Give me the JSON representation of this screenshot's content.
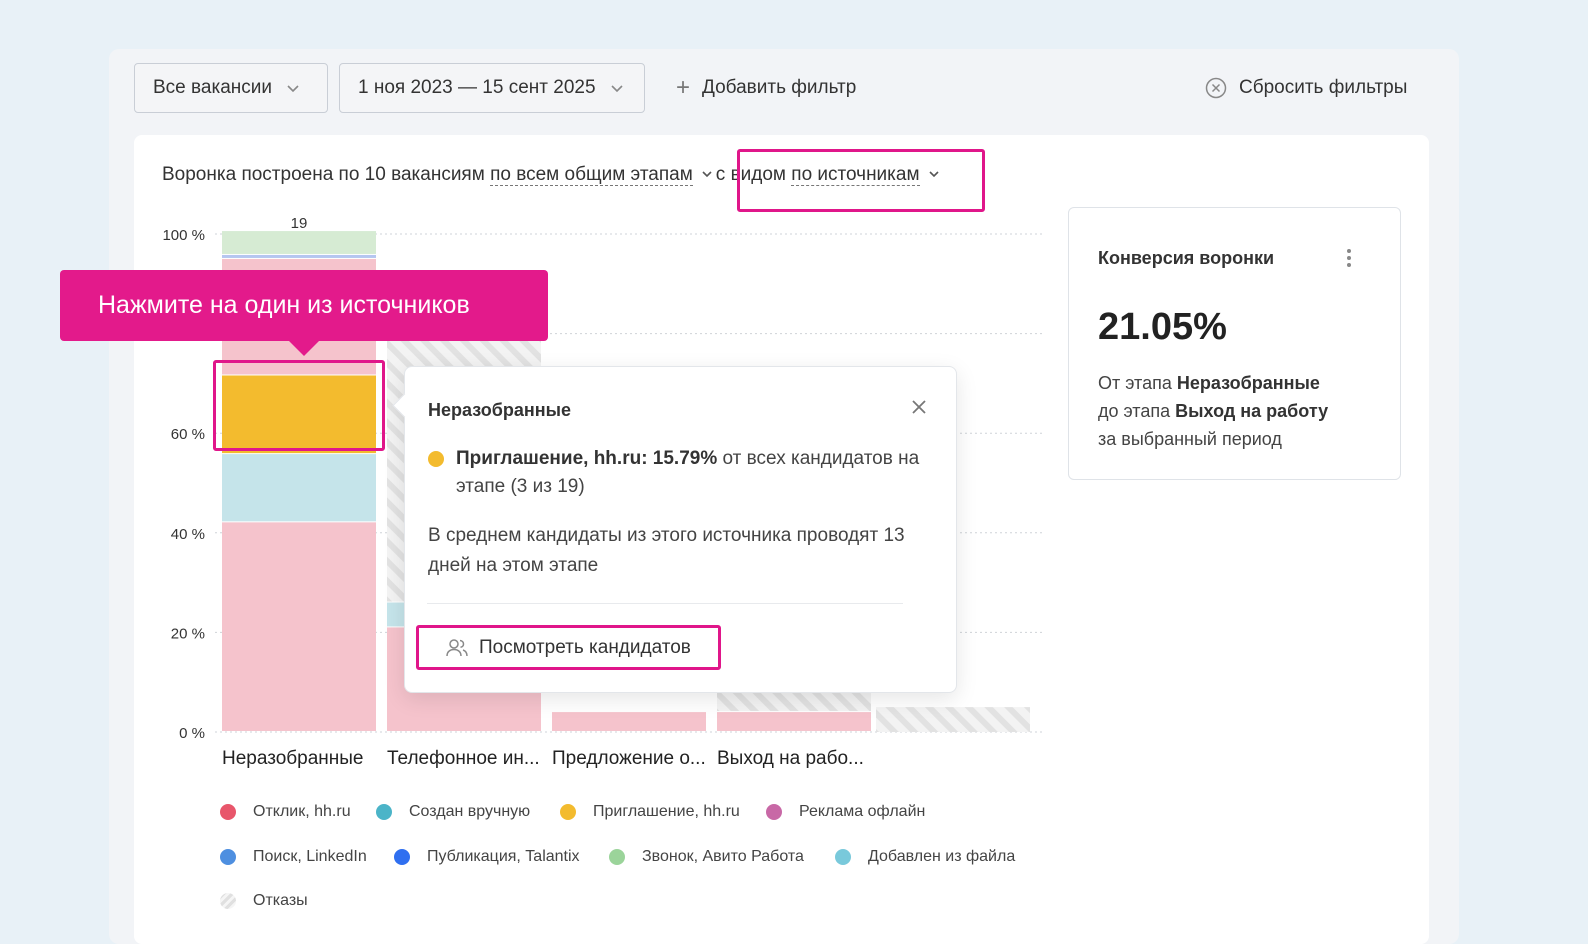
{
  "filters": {
    "vacancies_label": "Все вакансии",
    "period_label": "1 ноя 2023 — 15 сент 2025",
    "add_filter_label": "Добавить фильтр",
    "reset_label": "Сбросить фильтры"
  },
  "funnel": {
    "prefix": "Воронка построена по 10 вакансиям",
    "stages_option": "по всем общим этапам",
    "view_prefix": "с видом",
    "view_option": "по источникам"
  },
  "tour": {
    "callout": "Нажмите на один из источников"
  },
  "conversion": {
    "title": "Конверсия воронки",
    "value": "21.05%",
    "from_text": "От этапа",
    "from_stage": "Неразобранные",
    "to_text": "до этапа",
    "to_stage": "Выход на работу",
    "period_text": "за выбранный период"
  },
  "popup": {
    "title": "Неразобранные",
    "source_name": "Приглашение, hh.ru: 15.79%",
    "source_rest": "от всех кандидатов на этапе (3 из 19)",
    "avg_text": "В среднем кандидаты из этого источника проводят 13 дней на этом этапе",
    "button_label": "Посмотреть кандидатов",
    "dot_color": "#f3bb2e"
  },
  "chart_data": {
    "type": "bar",
    "stacked": true,
    "y_unit": "%",
    "ylim": [
      0,
      100
    ],
    "y_ticks": [
      "0 %",
      "20 %",
      "40 %",
      "60 %",
      "80 %",
      "100 %"
    ],
    "categories": [
      "Неразобранные",
      "Телефонное ин...",
      "Предложение о...",
      "Выход на рабо..."
    ],
    "totals": [
      "19",
      "",
      "",
      ""
    ],
    "series": [
      {
        "name": "Отклик, hh.ru",
        "color": "#f5c3cc",
        "values": [
          42.1,
          21,
          4,
          4
        ]
      },
      {
        "name": "Создан вручную",
        "color": "#c5e4ea",
        "values": [
          13.7,
          5,
          0,
          0
        ]
      },
      {
        "name": "Приглашение, hh.ru",
        "color": "#f3bb2e",
        "values": [
          15.79,
          0,
          0,
          0
        ]
      },
      {
        "name": "Реклама офлайн",
        "color": "#f5c3cc",
        "values": [
          23.4,
          0,
          0,
          0
        ]
      },
      {
        "name": "Поиск, LinkedIn",
        "color": "#b5c6f0",
        "values": [
          0,
          0,
          0,
          0
        ]
      },
      {
        "name": "Публикация, Talantix",
        "color": "#b5c6f0",
        "values": [
          0.8,
          0,
          0,
          0
        ]
      },
      {
        "name": "Звонок, Авито Работа",
        "color": "#d6ebd3",
        "values": [
          4.8,
          0,
          0,
          0
        ]
      },
      {
        "name": "Добавлен из файла",
        "color": "#c5e4ea",
        "values": [
          0,
          0,
          0,
          0
        ]
      },
      {
        "name": "Отказы",
        "color": "#e6e6e6",
        "values": [
          0,
          53,
          0,
          5
        ]
      }
    ],
    "legend": [
      {
        "label": "Отклик, hh.ru",
        "color": "#e8566b"
      },
      {
        "label": "Создан вручную",
        "color": "#4bb4c8"
      },
      {
        "label": "Приглашение, hh.ru",
        "color": "#f3bb2e"
      },
      {
        "label": "Реклама офлайн",
        "color": "#c868a6"
      },
      {
        "label": "Поиск, LinkedIn",
        "color": "#4e8fe0"
      },
      {
        "label": "Публикация, Talantix",
        "color": "#2f6ff0"
      },
      {
        "label": "Звонок, Авито Работа",
        "color": "#9bd49a"
      },
      {
        "label": "Добавлен из файла",
        "color": "#79c9db"
      },
      {
        "label": "Отказы",
        "color": "hatched"
      }
    ]
  }
}
